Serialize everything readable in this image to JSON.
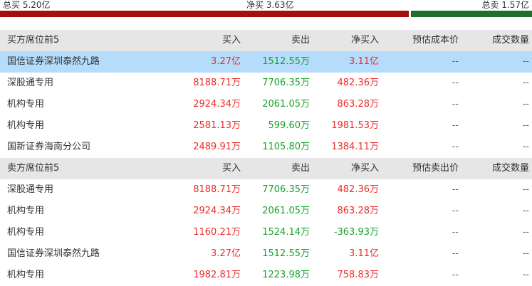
{
  "summary": {
    "total_buy": "总买 5.20亿",
    "net_buy": "净买 3.63亿",
    "total_sell": "总卖 1.57亿",
    "buy_ratio": 0.768,
    "buy_color": "#a50f10",
    "sell_color": "#1f6e2e"
  },
  "buy_section": {
    "header": [
      "买方席位前5",
      "买入",
      "卖出",
      "净买入",
      "预估成本价",
      "成交数量"
    ],
    "rows": [
      {
        "name": "国信证券深圳泰然九路",
        "buy": "3.27亿",
        "sell": "1512.55万",
        "net": "3.11亿",
        "est": "--",
        "vol": "--",
        "highlight": true
      },
      {
        "name": "深股通专用",
        "buy": "8188.71万",
        "sell": "7706.35万",
        "net": "482.36万",
        "est": "--",
        "vol": "--"
      },
      {
        "name": "机构专用",
        "buy": "2924.34万",
        "sell": "2061.05万",
        "net": "863.28万",
        "est": "--",
        "vol": "--"
      },
      {
        "name": "机构专用",
        "buy": "2581.13万",
        "sell": "599.60万",
        "net": "1981.53万",
        "est": "--",
        "vol": "--"
      },
      {
        "name": "国新证券海南分公司",
        "buy": "2489.91万",
        "sell": "1105.80万",
        "net": "1384.11万",
        "est": "--",
        "vol": "--"
      }
    ]
  },
  "sell_section": {
    "header": [
      "卖方席位前5",
      "买入",
      "卖出",
      "净买入",
      "预估卖出价",
      "成交数量"
    ],
    "rows": [
      {
        "name": "深股通专用",
        "buy": "8188.71万",
        "sell": "7706.35万",
        "net": "482.36万",
        "est": "--",
        "vol": "--"
      },
      {
        "name": "机构专用",
        "buy": "2924.34万",
        "sell": "2061.05万",
        "net": "863.28万",
        "est": "--",
        "vol": "--"
      },
      {
        "name": "机构专用",
        "buy": "1160.21万",
        "sell": "1524.14万",
        "net": "-363.93万",
        "est": "--",
        "vol": "--"
      },
      {
        "name": "国信证券深圳泰然九路",
        "buy": "3.27亿",
        "sell": "1512.55万",
        "net": "3.11亿",
        "est": "--",
        "vol": "--"
      },
      {
        "name": "机构专用",
        "buy": "1982.81万",
        "sell": "1223.98万",
        "net": "758.83万",
        "est": "--",
        "vol": "--"
      }
    ]
  },
  "colors": {
    "positive": "#ee2b2b",
    "negative": "#17a329",
    "highlight_row": "#b6dcfb",
    "header_bg": "#e6e6e6"
  }
}
